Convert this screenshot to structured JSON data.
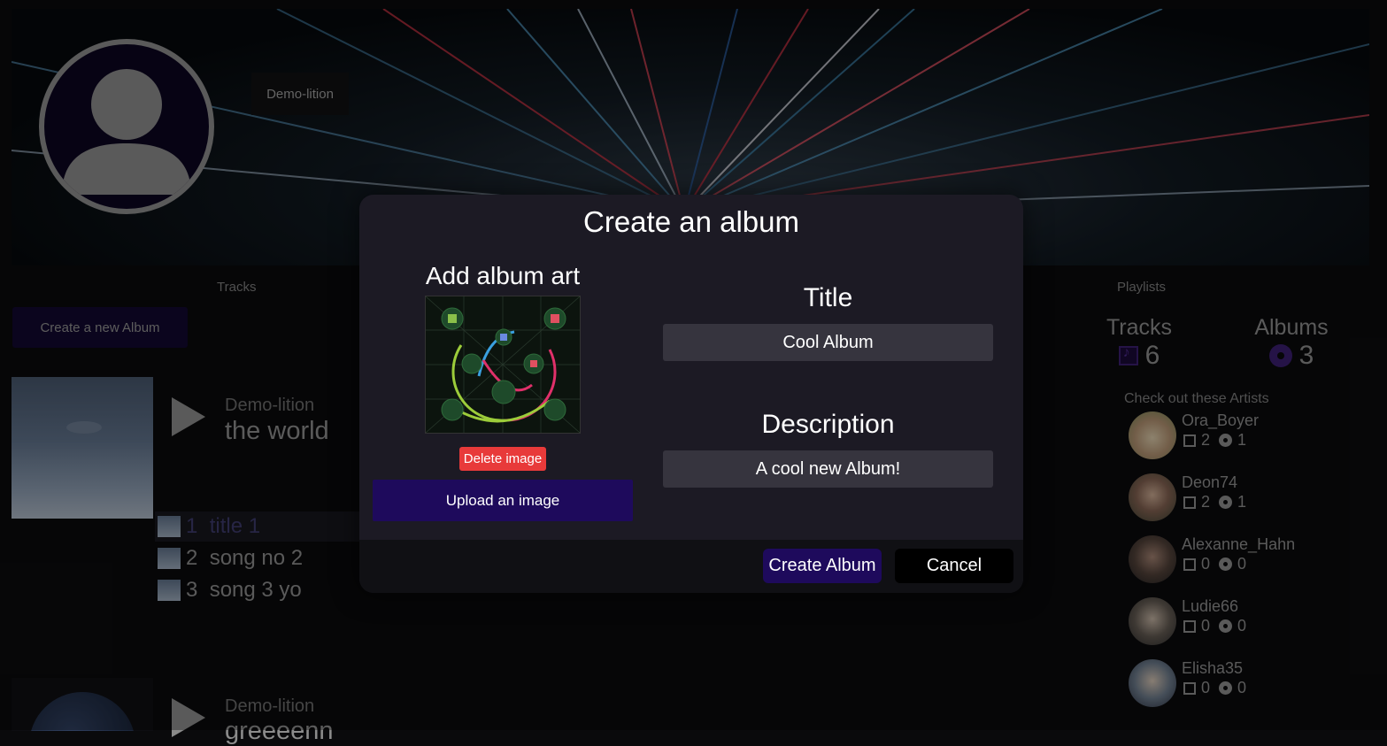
{
  "profile": {
    "artist_name": "Demo-lition"
  },
  "tabs": {
    "tracks": "Tracks",
    "playlists": "Playlists"
  },
  "actions": {
    "create_new_album": "Create a new Album"
  },
  "albums": [
    {
      "artist": "Demo-lition",
      "title": "the world",
      "tracks": [
        {
          "num": "1",
          "title": "title 1"
        },
        {
          "num": "2",
          "title": "song no 2"
        },
        {
          "num": "3",
          "title": "song 3 yo"
        }
      ]
    },
    {
      "artist": "Demo-lition",
      "title": "greeeenn"
    }
  ],
  "stats": {
    "tracks_label": "Tracks",
    "tracks_count": "6",
    "albums_label": "Albums",
    "albums_count": "3"
  },
  "suggested_artists": {
    "title": "Check out these Artists",
    "items": [
      {
        "name": "Ora_Boyer",
        "tracks": "2",
        "albums": "1"
      },
      {
        "name": "Deon74",
        "tracks": "2",
        "albums": "1"
      },
      {
        "name": "Alexanne_Hahn",
        "tracks": "0",
        "albums": "0"
      },
      {
        "name": "Ludie66",
        "tracks": "0",
        "albums": "0"
      },
      {
        "name": "Elisha35",
        "tracks": "0",
        "albums": "0"
      }
    ]
  },
  "modal": {
    "title": "Create an album",
    "art_label": "Add album art",
    "delete_image": "Delete image",
    "upload_image": "Upload an image",
    "title_label": "Title",
    "title_value": "Cool Album",
    "description_label": "Description",
    "description_value": "A cool new Album!",
    "create_button": "Create Album",
    "cancel_button": "Cancel"
  },
  "colors": {
    "accent": "#1e0a5c",
    "danger": "#e83a3a",
    "modal_bg": "#1c1a24"
  }
}
